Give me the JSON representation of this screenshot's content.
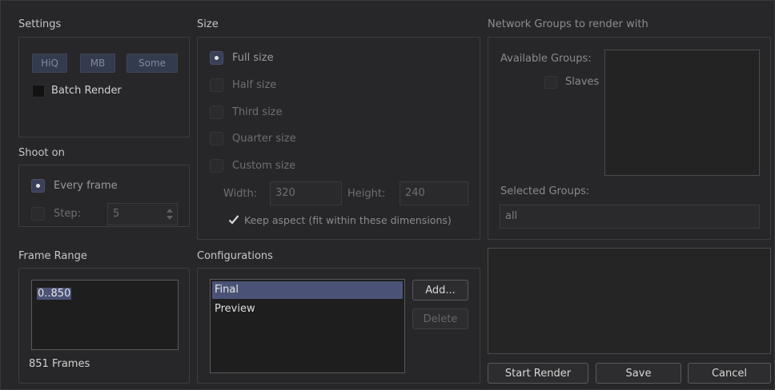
{
  "settings": {
    "title": "Settings",
    "toggles": [
      "HiQ",
      "MB",
      "Some"
    ],
    "batch_render": "Batch Render"
  },
  "shoot_on": {
    "title": "Shoot on",
    "every_frame": "Every frame",
    "step_label": "Step:",
    "step_value": "5"
  },
  "frame_range": {
    "title": "Frame Range",
    "range_text": "0..850",
    "frames_count": "851 Frames"
  },
  "size": {
    "title": "Size",
    "options": [
      "Full size",
      "Half size",
      "Third size",
      "Quarter size",
      "Custom size"
    ],
    "selected_index": 0,
    "width_label": "Width:",
    "width_value": "320",
    "height_label": "Height:",
    "height_value": "240",
    "keep_aspect": "Keep aspect (fit within these dimensions)"
  },
  "configurations": {
    "title": "Configurations",
    "items": [
      "Final",
      "Preview"
    ],
    "selected_index": 0,
    "add_button": "Add...",
    "delete_button": "Delete"
  },
  "network": {
    "title": "Network Groups to render with",
    "available_label": "Available Groups:",
    "slaves_label": "Slaves",
    "selected_label": "Selected Groups:",
    "selected_value": "all"
  },
  "footer": {
    "start_render": "Start Render",
    "save": "Save",
    "cancel": "Cancel"
  },
  "colors": {
    "background": "#272729",
    "selection": "#4a5375",
    "toggle_fill": "#343b4e"
  }
}
